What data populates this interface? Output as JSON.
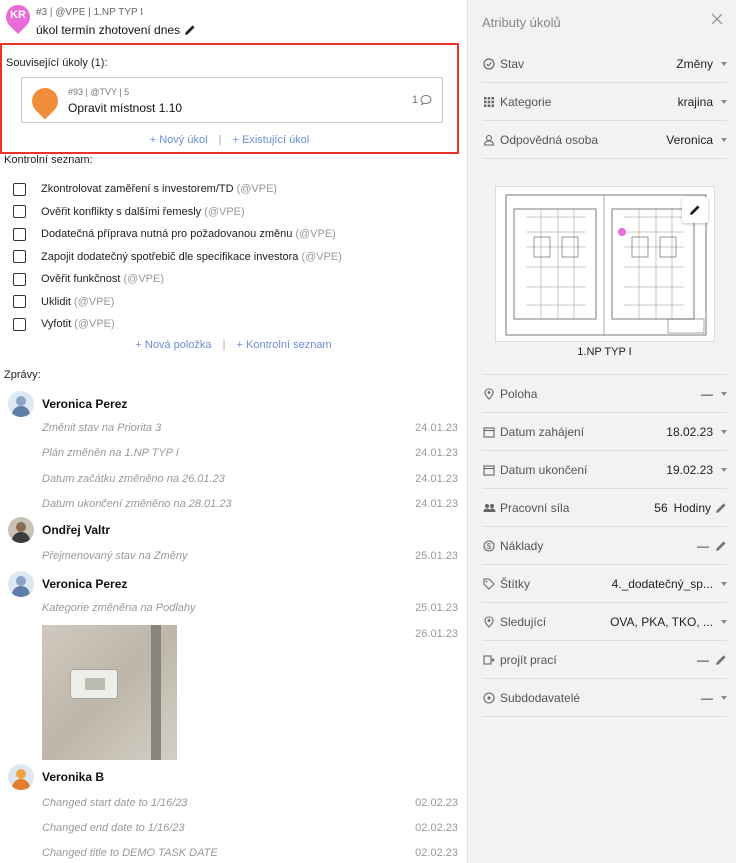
{
  "task": {
    "pin_initials": "KR",
    "meta": "#3 | @VPE | 1.NP TYP I",
    "title": "úkol termín zhotovení dnes"
  },
  "related": {
    "title": "Související úkoly (1):",
    "card": {
      "meta": "#93 | @TVY | 5",
      "title": "Opravit místnost 1.10",
      "comment_count": "1"
    },
    "new_task": "+ Nový úkol",
    "existing_task": "+ Existující úkol"
  },
  "checklist": {
    "title": "Kontrolní seznam:",
    "items": [
      {
        "text": "Zkontrolovat zaměření s investorem/TD",
        "owner": "(@VPE)"
      },
      {
        "text": "Ověřit konflikty s dalšími řemesly",
        "owner": "(@VPE)"
      },
      {
        "text": "Dodatečná příprava nutná pro požadovanou změnu",
        "owner": "(@VPE)"
      },
      {
        "text": "Zapojit dodatečný spotřebič dle specifikace investora",
        "owner": "(@VPE)"
      },
      {
        "text": "Ověřit funkčnost",
        "owner": "(@VPE)"
      },
      {
        "text": "Uklidit",
        "owner": "(@VPE)"
      },
      {
        "text": "Vyfotit",
        "owner": "(@VPE)"
      }
    ],
    "new_item": "+ Nová položka",
    "new_list": "+ Kontrolní seznam"
  },
  "messages": {
    "title": "Zprávy:",
    "groups": [
      {
        "author": "Veronica Perez",
        "lines": [
          {
            "text": "Změnit stav na Priorita 3",
            "date": "24.01.23"
          },
          {
            "text": "Plán změněn na 1.NP TYP I",
            "date": "24.01.23"
          },
          {
            "text": "Datum začátku změněno na 26.01.23",
            "date": "24.01.23"
          },
          {
            "text": "Datum ukončení změněno na 28.01.23",
            "date": "24.01.23"
          }
        ]
      },
      {
        "author": "Ondřej Valtr",
        "lines": [
          {
            "text": "Přejmenovaný stav na Změny",
            "date": "25.01.23"
          }
        ]
      },
      {
        "author": "Veronica Perez",
        "lines": [
          {
            "text": "Kategorie změněna na Podlahy",
            "date": "25.01.23"
          }
        ],
        "photo_date": "26.01.23"
      },
      {
        "author": "Veronika B",
        "lines": [
          {
            "text": "Changed start date to 1/16/23",
            "date": "02.02.23"
          },
          {
            "text": "Changed end date to 1/16/23",
            "date": "02.02.23"
          },
          {
            "text": "Changed title to DEMO TASK DATE",
            "date": "02.02.23"
          }
        ]
      }
    ]
  },
  "attributes": {
    "title": "Atributy úkolů",
    "stav": {
      "label": "Stav",
      "value": "Změny"
    },
    "kategorie": {
      "label": "Kategorie",
      "value": "krajina"
    },
    "osoba": {
      "label": "Odpovědná osoba",
      "value": "Veronica"
    },
    "plan_name": "1.NP TYP I",
    "poloha": {
      "label": "Poloha",
      "value": "—"
    },
    "zahajeni": {
      "label": "Datum zahájení",
      "value": "18.02.23"
    },
    "ukonceni": {
      "label": "Datum ukončení",
      "value": "19.02.23"
    },
    "sila": {
      "label": "Pracovní síla",
      "value": "56",
      "unit": "Hodiny"
    },
    "naklady": {
      "label": "Náklady",
      "value": "—"
    },
    "stitky": {
      "label": "Štítky",
      "value": "4._dodatečný_sp..."
    },
    "sledujici": {
      "label": "Sledující",
      "value": "OVA, PKA, TKO, ..."
    },
    "prace": {
      "label": "projít prací",
      "value": "—"
    },
    "subdodavatele": {
      "label": "Subdodavatelé",
      "value": "—"
    }
  },
  "colors": {
    "accent_link": "#6b8fd6",
    "highlight_border": "#e8322a",
    "task_pin": "#e86bd8",
    "related_pin": "#f08c3a"
  }
}
